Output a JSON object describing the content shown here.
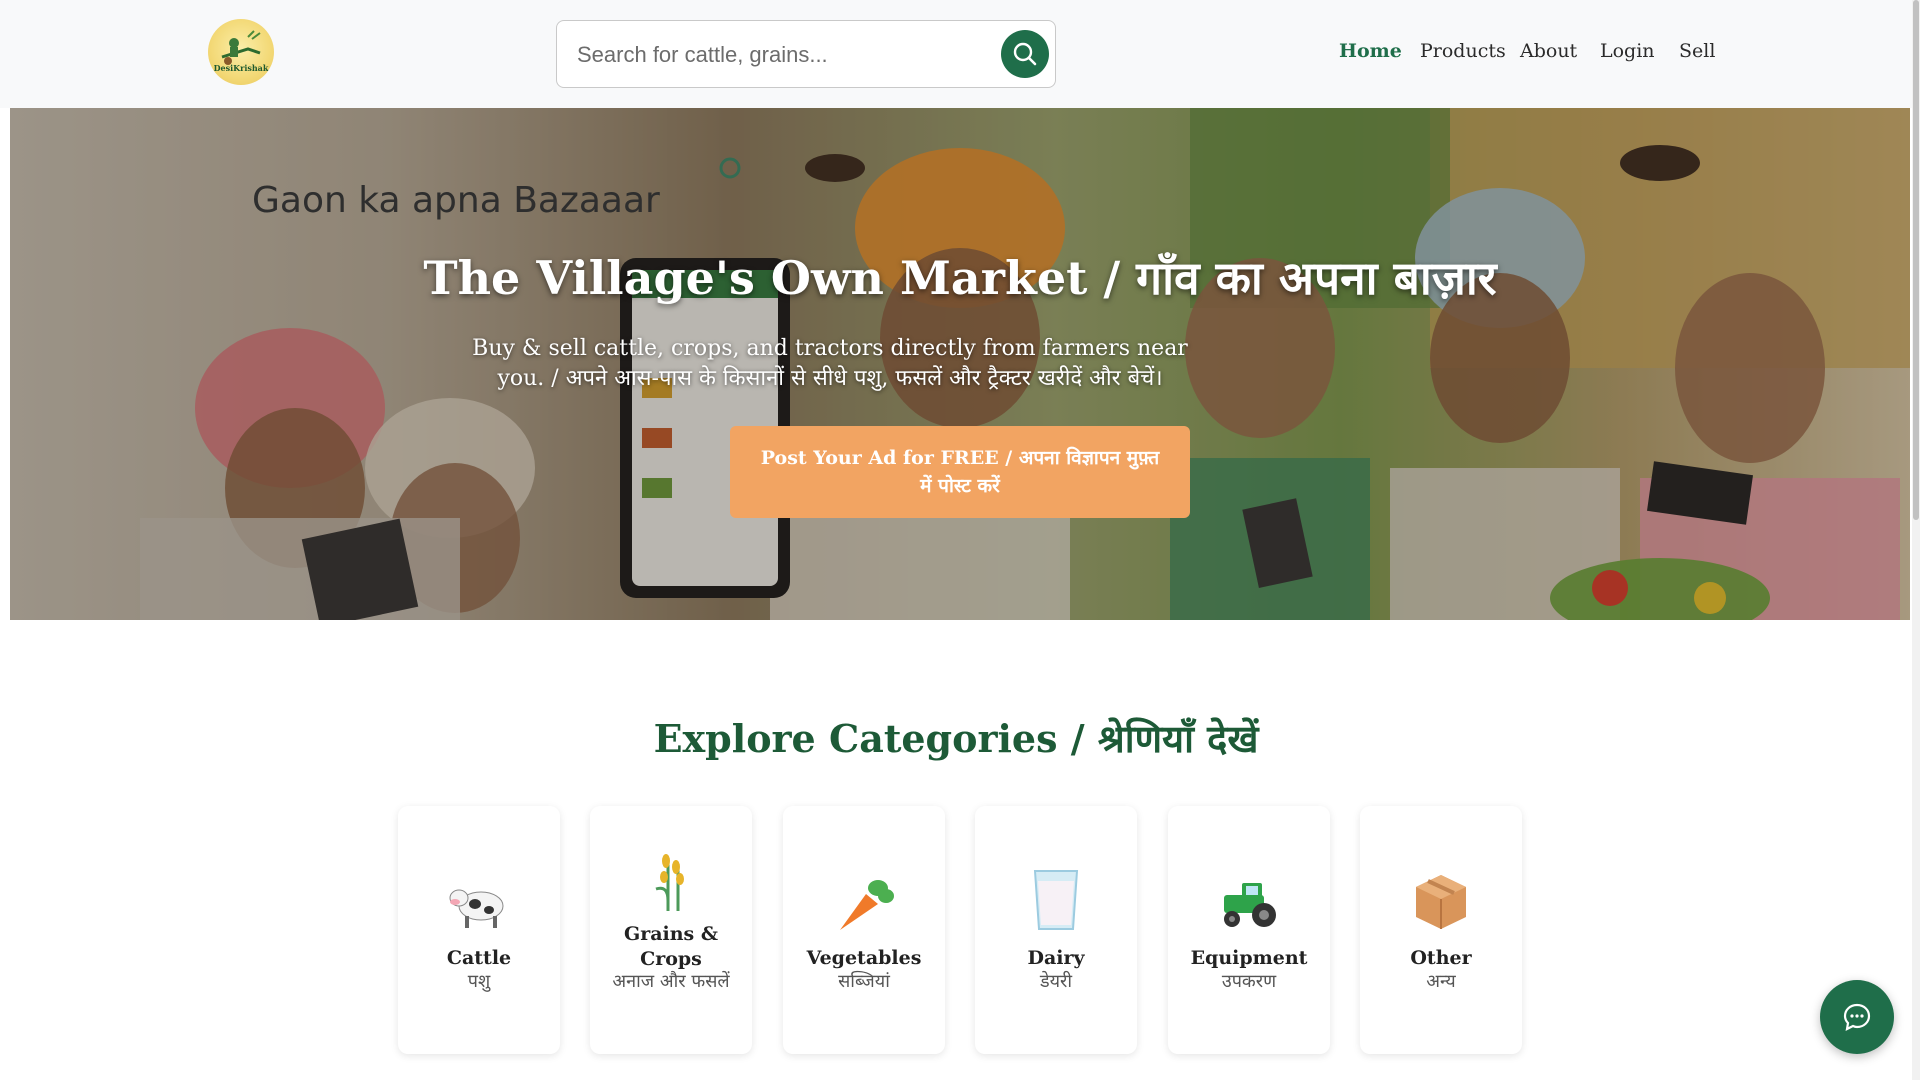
{
  "header": {
    "logo_text": "DesiKrishak",
    "search_placeholder": "Search for cattle, grains...",
    "nav": [
      {
        "label": "Home",
        "active": true
      },
      {
        "label": "Products",
        "active": false
      },
      {
        "label": "About",
        "active": false
      },
      {
        "label": "Login",
        "active": false
      },
      {
        "label": "Sell",
        "active": false
      }
    ]
  },
  "hero": {
    "tagline": "Gaon ka apna Bazaaar",
    "title": "The Village's Own Market / गाँव का अपना बाज़ार",
    "subtitle": "Buy & sell cattle, crops, and tractors directly from farmers near you. / अपने आस-पास के किसानों से सीधे पशु, फसलें और ट्रैक्टर खरीदें और बेचें।",
    "cta": "Post Your Ad for FREE / अपना विज्ञापन मुफ़्त में पोस्ट करें"
  },
  "categories": {
    "title": "Explore Categories / श्रेणियाँ देखें",
    "items": [
      {
        "en": "Cattle",
        "hi": "पशु",
        "icon": "cow-icon"
      },
      {
        "en": "Grains & Crops",
        "hi": "अनाज और फसलें",
        "icon": "wheat-icon"
      },
      {
        "en": "Vegetables",
        "hi": "सब्जियां",
        "icon": "carrot-icon"
      },
      {
        "en": "Dairy",
        "hi": "डेयरी",
        "icon": "milk-glass-icon"
      },
      {
        "en": "Equipment",
        "hi": "उपकरण",
        "icon": "tractor-icon"
      },
      {
        "en": "Other",
        "hi": "अन्य",
        "icon": "package-icon"
      }
    ]
  },
  "colors": {
    "brand_green": "#1f6e4a",
    "cta_orange": "#f2a462",
    "heading_green": "#1d5a37"
  },
  "chat": {
    "icon": "chat-bubble-icon"
  }
}
